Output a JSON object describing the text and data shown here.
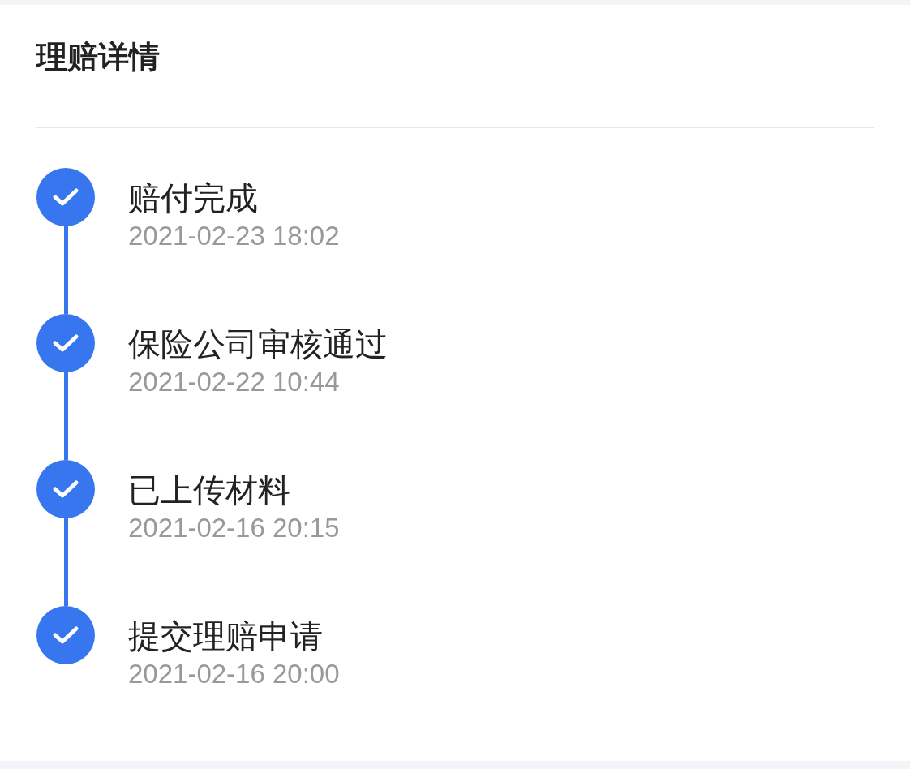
{
  "title": "理赔详情",
  "steps": [
    {
      "label": "赔付完成",
      "time": "2021-02-23 18:02",
      "done": true
    },
    {
      "label": "保险公司审核通过",
      "time": "2021-02-22 10:44",
      "done": true
    },
    {
      "label": "已上传材料",
      "time": "2021-02-16 20:15",
      "done": true
    },
    {
      "label": "提交理赔申请",
      "time": "2021-02-16 20:00",
      "done": true
    }
  ]
}
